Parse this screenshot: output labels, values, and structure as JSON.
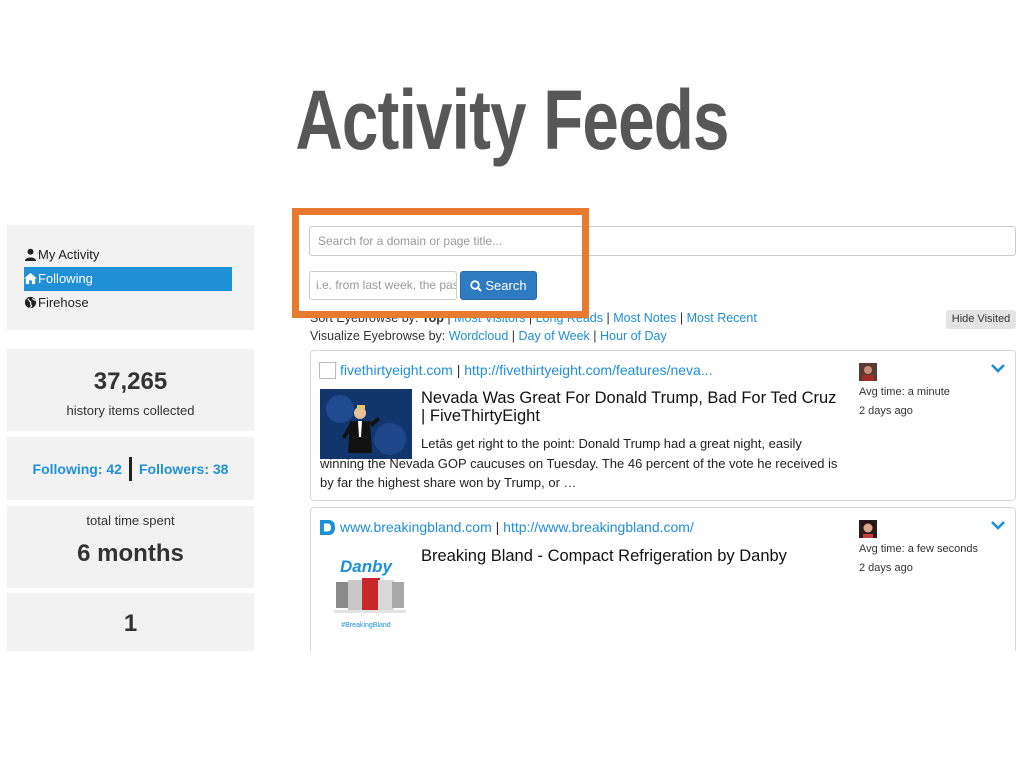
{
  "slide": {
    "title": "Activity Feeds"
  },
  "nav": {
    "items": [
      {
        "label": "My Activity",
        "icon": "user-icon",
        "active": false
      },
      {
        "label": "Following",
        "icon": "home-icon",
        "active": true
      },
      {
        "label": "Firehose",
        "icon": "globe-icon",
        "active": false
      }
    ]
  },
  "stats": {
    "history_count": "37,265",
    "history_label": "history items collected",
    "following": "Following: 42",
    "followers": "Followers: 38",
    "time_label": "total time spent",
    "time_value": "6 months",
    "fourth_value": "1"
  },
  "search": {
    "placeholder": "Search for a domain or page title...",
    "date_placeholder": "i.e. from last week, the past",
    "button_label": "Search"
  },
  "sort": {
    "prefix": "Sort Eyebrowse by:",
    "top": "Top",
    "most_visitors": "Most Visitors",
    "long_reads": "Long Reads",
    "most_notes": "Most Notes",
    "most_recent": "Most Recent"
  },
  "visualize": {
    "prefix": "Visualize Eyebrowse by:",
    "wordcloud": "Wordcloud",
    "day_of_week": "Day of Week",
    "hour_of_day": "Hour of Day"
  },
  "hide_visited_label": "Hide Visited",
  "feed": [
    {
      "domain": "fivethirtyeight.com",
      "url": "http://fivethirtyeight.com/features/neva...",
      "title": "Nevada Was Great For Donald Trump, Bad For Ted Cruz | FiveThirtyEight",
      "description": "Letâs get right to the point: Donald Trump had a great night, easily winning the Nevada GOP caucuses on Tuesday. The 46 percent of the vote he received is by far the highest share won by Trump, or …",
      "avg_time": "Avg time: a minute",
      "ago": "2 days ago"
    },
    {
      "domain": "www.breakingbland.com",
      "url": "http://www.breakingbland.com/",
      "title": "Breaking Bland - Compact Refrigeration by Danby",
      "thumb_brand": "Danby",
      "thumb_tag": "#BreakingBland",
      "avg_time": "Avg time: a few seconds",
      "ago": "2 days ago"
    }
  ],
  "colors": {
    "accent": "#1f8fd6",
    "highlight": "#e87b2f",
    "button": "#2f7bc1"
  }
}
